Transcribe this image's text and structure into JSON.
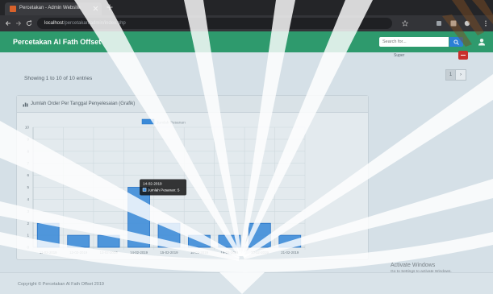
{
  "browser": {
    "tab_title": "Percetakan - Admin Website",
    "url_host": "localhost",
    "url_path": "/percetakan/admin/index.php",
    "icons": [
      "favicon-icon",
      "close-icon",
      "plus-icon",
      "back-icon",
      "forward-icon",
      "reload-icon",
      "star-icon",
      "extension-icon",
      "profile-icon",
      "menu-icon"
    ]
  },
  "navbar": {
    "brand": "Percetakan Al Fath Offset",
    "search_placeholder": "Search for...",
    "icons": [
      "search-icon",
      "user-icon"
    ]
  },
  "account": {
    "name": "Super"
  },
  "table": {
    "info": "Showing 1 to 10 of 10 entries",
    "pagination": [
      "1",
      "›"
    ]
  },
  "card": {
    "title": "Jumlah Order Per Tanggal Penyelesaian (Grafik)",
    "icon": "bar-chart-icon"
  },
  "chart_data": {
    "type": "bar",
    "categories": [
      "11-02-2019",
      "12-02-2019",
      "13-02-2019",
      "14-02-2019",
      "15-02-2019",
      "18-02-2019",
      "19-02-2019",
      "20-02-2019",
      "21-02-2019"
    ],
    "series": [
      {
        "name": "Jumlah Pesanan",
        "values": [
          2,
          1,
          1,
          5,
          2,
          1,
          1,
          2,
          1
        ]
      }
    ],
    "ylim": [
      0,
      10
    ],
    "yticks": [
      0,
      1,
      2,
      3,
      4,
      5,
      6,
      7,
      8,
      9,
      10
    ],
    "grid": true,
    "legend": "top-center",
    "tooltip": {
      "index": 3,
      "title": "14-02-2019",
      "label": "Jumlah Pesanan: 5"
    }
  },
  "footer": {
    "copyright": "Copyright © Percetakan Al Fath Offset 2019"
  },
  "os_notice": {
    "title": "Activate Windows",
    "subtitle": "Go to Settings to activate Windows."
  },
  "colors": {
    "navbar": "#2e9a6d",
    "bar": "#3a8ad8",
    "search_button": "#2b7fd6",
    "danger": "#c9302c"
  }
}
